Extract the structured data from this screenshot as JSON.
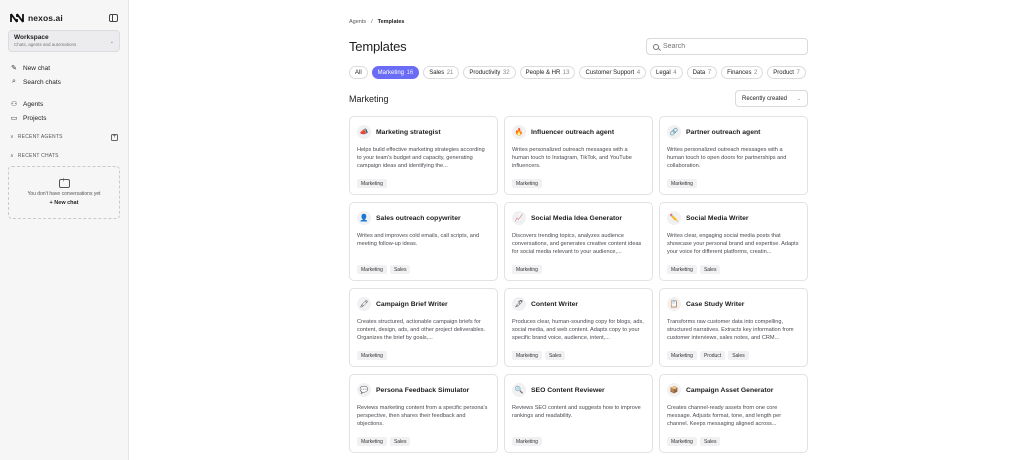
{
  "sidebar": {
    "brand": "nexos.ai",
    "workspace": {
      "name": "Workspace",
      "subtitle": "Chats, agents and automations"
    },
    "nav": [
      {
        "label": "New chat",
        "icon": "edit-icon"
      },
      {
        "label": "Search chats",
        "icon": "search-icon"
      },
      {
        "label": "Agents",
        "icon": "agents-icon"
      },
      {
        "label": "Projects",
        "icon": "folder-icon"
      }
    ],
    "recent_agents": "RECENT AGENTS",
    "recent_chats": "RECENT CHATS",
    "empty_text": "You don't have conversations yet",
    "new_chat_link": "+ New chat"
  },
  "breadcrumb": {
    "parent": "Agents",
    "separator": "/",
    "current": "Templates"
  },
  "page_title": "Templates",
  "search": {
    "placeholder": "Search"
  },
  "tabs": [
    {
      "label": "All",
      "count": ""
    },
    {
      "label": "Marketing",
      "count": "16",
      "active": true
    },
    {
      "label": "Sales",
      "count": "21"
    },
    {
      "label": "Productivity",
      "count": "32"
    },
    {
      "label": "People & HR",
      "count": "13"
    },
    {
      "label": "Customer Support",
      "count": "4"
    },
    {
      "label": "Legal",
      "count": "4"
    },
    {
      "label": "Data",
      "count": "7"
    },
    {
      "label": "Finances",
      "count": "2"
    },
    {
      "label": "Product",
      "count": "7"
    }
  ],
  "section": {
    "title": "Marketing",
    "sort": "Recently created"
  },
  "cards": [
    {
      "icon": "📣",
      "title": "Marketing strategist",
      "desc": "Helps build effective marketing strategies according to your team's budget and capacity, generating campaign ideas and identifying the...",
      "tags": [
        "Marketing"
      ]
    },
    {
      "icon": "🔥",
      "title": "Influencer outreach agent",
      "desc": "Writes personalized outreach messages with a human touch to Instagram, TikTok, and YouTube influencers.",
      "tags": [
        "Marketing"
      ]
    },
    {
      "icon": "🔗",
      "title": "Partner outreach agent",
      "desc": "Writes personalized outreach messages with a human touch to open doors for partnerships and collaboration.",
      "tags": [
        "Marketing"
      ]
    },
    {
      "icon": "👤",
      "title": "Sales outreach copywriter",
      "desc": "Writes and improves cold emails, call scripts, and meeting follow-up ideas.",
      "tags": [
        "Marketing",
        "Sales"
      ]
    },
    {
      "icon": "📈",
      "title": "Social Media Idea Generator",
      "desc": "Discovers trending topics, analyzes audience conversations, and generates creative content ideas for social media relevant to your audience,...",
      "tags": [
        "Marketing"
      ]
    },
    {
      "icon": "✏️",
      "title": "Social Media Writer",
      "desc": "Writes clear, engaging social media posts that showcase your personal brand and expertise. Adapts your voice for different platforms, creatin...",
      "tags": [
        "Marketing",
        "Sales"
      ]
    },
    {
      "icon": "🖍",
      "title": "Campaign Brief Writer",
      "desc": "Creates structured, actionable campaign briefs for content, design, ads, and other project deliverables. Organizes the brief by goals,...",
      "tags": [
        "Marketing"
      ]
    },
    {
      "icon": "🖋",
      "title": "Content Writer",
      "desc": "Produces clear, human-sounding copy for blogs, ads, social media, and web content. Adapts copy to your specific brand voice, audience, intent,...",
      "tags": [
        "Marketing",
        "Sales"
      ]
    },
    {
      "icon": "📋",
      "title": "Case Study Writer",
      "desc": "Transforms raw customer data into compelling, structured narratives. Extracts key information from customer interviews, sales notes, and CRM...",
      "tags": [
        "Marketing",
        "Product",
        "Sales"
      ]
    },
    {
      "icon": "💬",
      "title": "Persona Feedback Simulator",
      "desc": "Reviews marketing content from a specific persona's perspective, then shares their feedback and objections.",
      "tags": [
        "Marketing",
        "Sales"
      ]
    },
    {
      "icon": "🔍",
      "title": "SEO Content Reviewer",
      "desc": "Reviews SEO content and suggests how to improve rankings and readability.",
      "tags": [
        "Marketing"
      ]
    },
    {
      "icon": "📦",
      "title": "Campaign Asset Generator",
      "desc": "Creates channel-ready assets from one core message. Adjusts format, tone, and length per channel. Keeps messaging aligned across...",
      "tags": [
        "Marketing",
        "Sales"
      ]
    }
  ]
}
